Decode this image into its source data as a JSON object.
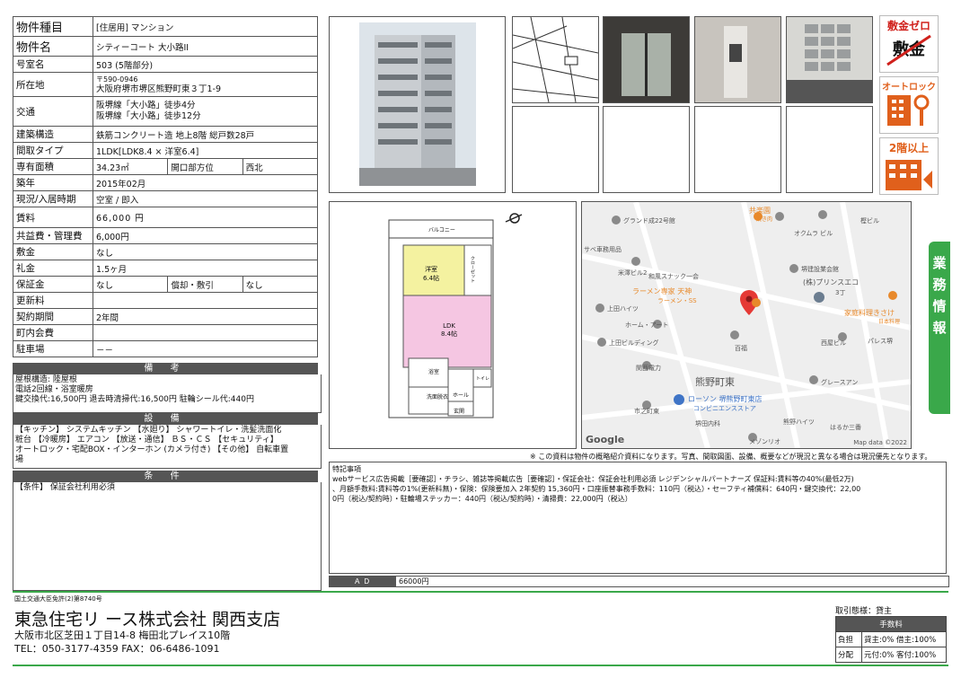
{
  "property": {
    "type_label": "物件種目",
    "type_value": "[住居用] マンション",
    "name_label": "物件名",
    "name_value": "シティーコート 大小路II",
    "room_label": "号室名",
    "room_value": "503 (5階部分)",
    "address_label": "所在地",
    "postal": "〒590-0946",
    "address": "大阪府堺市堺区熊野町東３丁1-9",
    "access_label": "交通",
    "access1": "阪堺線「大小路」徒歩4分",
    "access2": "阪堺線「大小路」徒歩12分",
    "structure_label": "建築構造",
    "structure_value": "鉄筋コンクリート造 地上8階 総戸数28戸",
    "layout_label": "間取タイプ",
    "layout_value": "1LDK[LDK8.4 × 洋室6.4]",
    "area_label": "専有面積",
    "area_value": "34.23㎡",
    "window_label": "開口部方位",
    "window_value": "西北",
    "built_label": "築年",
    "built_value": "2015年02月",
    "status_label": "現況/入居時期",
    "status_value": "空室 / 即入",
    "rent_label": "賃料",
    "rent_value": "66,000 円",
    "mgmt_label": "共益費・管理費",
    "mgmt_value": "6,000円",
    "deposit_label": "敷金",
    "deposit_value": "なし",
    "key_label": "礼金",
    "key_value": "1.5ヶ月",
    "guarantee_label": "保証金",
    "guarantee_value": "なし",
    "amort_label": "償却・敷引",
    "amort_value": "なし",
    "renew_label": "更新料",
    "renew_value": "",
    "contract_label": "契約期間",
    "contract_value": "2年間",
    "town_label": "町内会費",
    "town_value": "",
    "parking_label": "駐車場",
    "parking_value": "－－"
  },
  "remarks": {
    "title": "備 考",
    "line1": "屋根構造: 陸屋根",
    "line2": "電話2回線・浴室暖房",
    "line3": "鍵交換代:16,500円 退去時清掃代:16,500円 駐輪シール代:440円"
  },
  "equipment": {
    "title": "設 備",
    "line1": "【キッチン】 システムキッチン 【水廻り】 シャワートイレ・洗髪洗面化",
    "line2": "粧台 【冷暖房】 エアコン 【放送・通信】 ＢＳ・ＣＳ 【セキュリティ】",
    "line3": "オートロック・宅配BOX・インターホン (カメラ付き) 【その他】 自転車置",
    "line4": "場"
  },
  "conditions": {
    "title": "条 件",
    "line1": "【条件】 保証会社利用必須"
  },
  "icons": {
    "no_deposit_top": "敷金ゼロ",
    "no_deposit_mid": "敷金",
    "autolock": "オートロック",
    "floor2": "2階以上"
  },
  "side_tab": [
    "業",
    "務",
    "情",
    "報"
  ],
  "floorplan": {
    "balcony": "バルコニー",
    "western": "洋室",
    "western_size": "6.4帖",
    "closet": "クローゼット",
    "ldk": "LDK",
    "ldk_size": "8.4帖",
    "bath": "浴室",
    "wash": "洗面脱衣",
    "toilet": "トイレ",
    "hall": "ホール",
    "entrance": "玄関"
  },
  "map": {
    "labels": [
      "グランド成22号館",
      "共楽園",
      "焼き肉",
      "オクムラ ビル",
      "樫ビル",
      "サベ車務用品",
      "米澤ビル2",
      "和風スナック一会",
      "堺建設業会館",
      "(株)プリンスエコ",
      "3丁",
      "ラーメン専家 天神",
      "ラーメン・SS",
      "上田ハイツ",
      "家庭料理きさけ",
      "日本料理",
      "ホーム・アート",
      "上田ビルディング",
      "百福",
      "西屋ビル",
      "パレス堺",
      "関西電力",
      "熊野町東",
      "グレースアン",
      "ローソン 堺熊野町東店",
      "コンビニエンスストア",
      "市之町東",
      "堺田内科",
      "熊野ハイツ",
      "はるか三番",
      "メゾンリオ"
    ],
    "google": "Google",
    "copyright": "Map data ©2022"
  },
  "disclaimer": "※ この資料は物件の概略紹介資料になります。写真、間取図面、設備、概要などが現況と異なる場合は現況優先となります。",
  "special": {
    "title": "特記事項",
    "line1": "webサービス広告掲載［要確認］・チラシ、雑誌等掲載広告［要確認］・保証会社：保証会社利用必須 レジデンシャルパートナーズ 保証料:賃料等の40%(最低2万)",
    "line2": "、月額手数料:賃料等の1%(更新料無)・保険：保険要加入 2年契約 15,360円・口座振替事務手数料：110円（税込）・セーフティ補償料：640円・鍵交換代：22,00",
    "line3": "0円（税込/契約時）・駐輪場ステッカー：440円（税込/契約時）・清掃費：22,000円（税込）"
  },
  "ad": {
    "label": "Ａ Ｄ",
    "value": "66000円"
  },
  "company": {
    "license": "国土交通大臣免許(2)第8740号",
    "name": "東急住宅リ ース株式会社 関西支店",
    "address": "大阪市北区芝田１丁目14-8 梅田北プレイス10階",
    "tel": "TEL：050-3177-4359 FAX：06-6486-1091"
  },
  "fees": {
    "transaction": "取引態様：貸主",
    "header": "手数料",
    "burden": "負担",
    "burden_value": "貸主:0% 借主:100%",
    "split": "分配",
    "split_value": "元付:0% 客付:100%"
  },
  "colors": {
    "green": "#3aa84a",
    "header_gray": "#555555",
    "orange": "#e0601c",
    "red": "#d0211c"
  }
}
